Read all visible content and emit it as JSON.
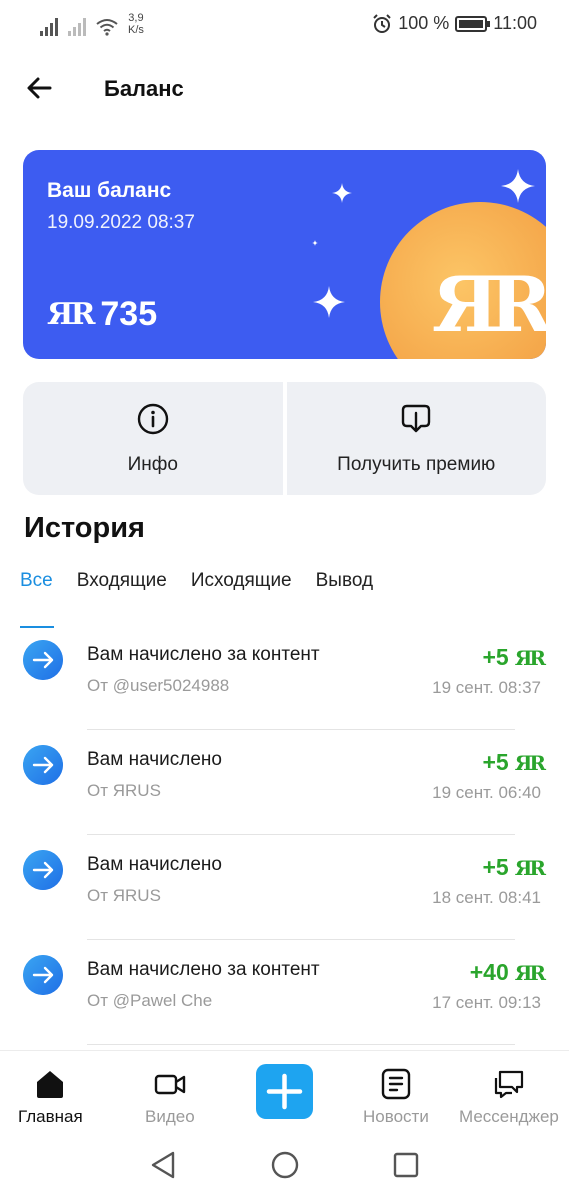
{
  "status_bar": {
    "speed_value": "3,9",
    "speed_unit": "K/s",
    "battery": "100 %",
    "time": "11:00"
  },
  "header": {
    "title": "Баланс"
  },
  "balance_card": {
    "label": "Ваш баланс",
    "datetime": "19.09.2022 08:37",
    "amount": "735",
    "colors": {
      "background": "#3d5cf1",
      "coin": "#f5a84b"
    }
  },
  "actions": [
    {
      "label": "Инфо",
      "icon": "info-icon"
    },
    {
      "label": "Получить премию",
      "icon": "download-icon"
    }
  ],
  "history": {
    "title": "История",
    "tabs": [
      "Все",
      "Входящие",
      "Исходящие",
      "Вывод"
    ],
    "active_tab": "Все",
    "items": [
      {
        "title": "Вам начислено за контент",
        "from": "От @user5024988",
        "amount": "+5",
        "date": "19 сент. 08:37"
      },
      {
        "title": "Вам начислено",
        "from": "От ЯRUS",
        "amount": "+5",
        "date": "19 сент. 06:40"
      },
      {
        "title": "Вам начислено",
        "from": "От ЯRUS",
        "amount": "+5",
        "date": "18 сент. 08:41"
      },
      {
        "title": "Вам начислено за контент",
        "from": "От @Pawel Che",
        "amount": "+40",
        "date": "17 сент. 09:13"
      }
    ],
    "amount_color": "#2aa52c"
  },
  "bottom_nav": {
    "items": [
      {
        "label": "Главная",
        "icon": "home-icon",
        "active": true
      },
      {
        "label": "Видео",
        "icon": "video-icon",
        "active": false
      },
      {
        "label": "Новости",
        "icon": "news-icon",
        "active": false
      },
      {
        "label": "Мессенджер",
        "icon": "messenger-icon",
        "active": false
      }
    ],
    "plus_icon": "plus-icon",
    "accent": "#1ea4f0"
  }
}
